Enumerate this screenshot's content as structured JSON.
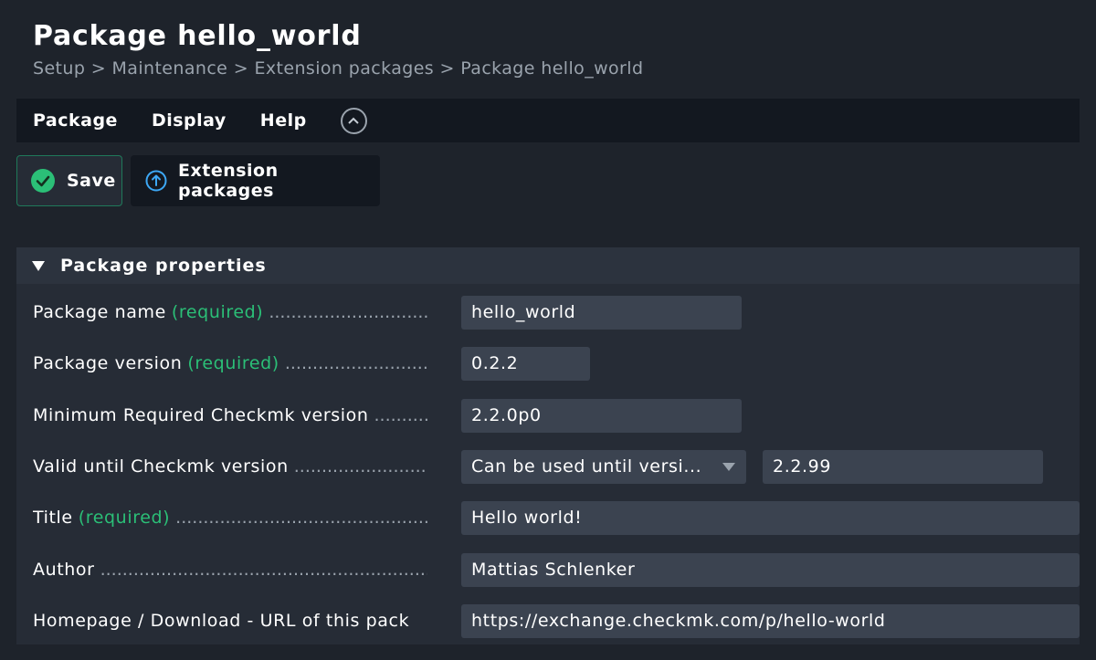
{
  "header": {
    "title": "Package hello_world",
    "breadcrumb": "Setup > Maintenance > Extension packages > Package hello_world"
  },
  "menu": {
    "items": [
      "Package",
      "Display",
      "Help"
    ],
    "collapse_icon": "chevron-up-circle-icon"
  },
  "toolbar": {
    "save_label": "Save",
    "extension_packages_label": "Extension packages",
    "save_icon": "check-circle-icon",
    "extension_icon": "arrow-up-circle-icon"
  },
  "section": {
    "title": "Package properties"
  },
  "form": {
    "required_text": "(required)",
    "package_name": {
      "label": "Package name",
      "value": "hello_world"
    },
    "package_version": {
      "label": "Package version",
      "value": "0.2.2"
    },
    "min_version": {
      "label": "Minimum Required Checkmk version",
      "value": "2.2.0p0"
    },
    "valid_until": {
      "label": "Valid until Checkmk version",
      "select_value": "Can be used until versi...",
      "value": "2.2.99"
    },
    "title": {
      "label": "Title",
      "value": "Hello world!"
    },
    "author": {
      "label": "Author",
      "value": "Mattias Schlenker"
    },
    "homepage": {
      "label": "Homepage / Download - URL of this pack",
      "value": "https://exchange.checkmk.com/p/hello-world"
    }
  },
  "colors": {
    "background": "#1e232b",
    "accent_green": "#2bbf77",
    "accent_blue": "#3da8f5",
    "input_bg": "#3b4350"
  }
}
